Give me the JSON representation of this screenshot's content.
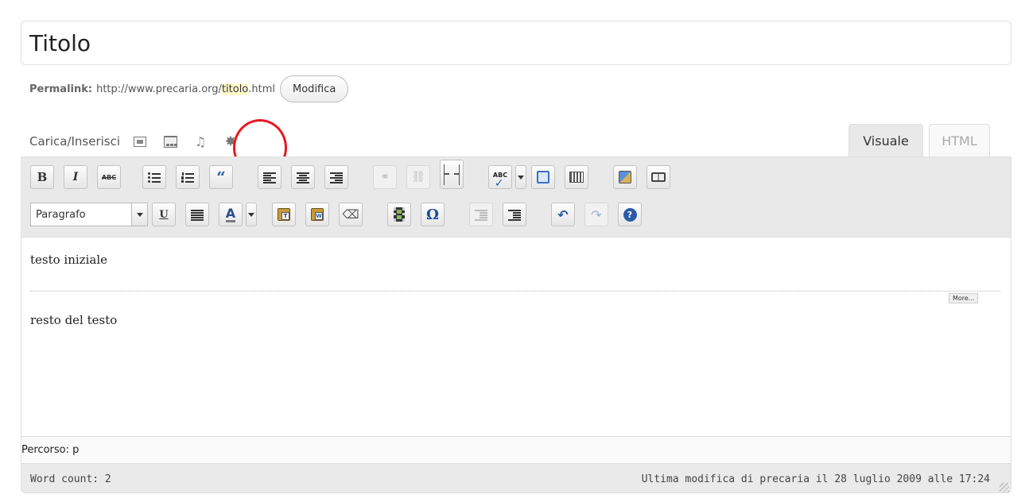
{
  "title": {
    "value": "Titolo"
  },
  "permalink": {
    "label": "Permalink:",
    "url_prefix": "http://www.precaria.org/",
    "slug": "titolo",
    "url_suffix": ".html",
    "edit_button": "Modifica"
  },
  "media": {
    "label": "Carica/Inserisci",
    "icons": [
      "image-icon",
      "video-icon",
      "audio-icon",
      "media-icon"
    ]
  },
  "tabs": [
    {
      "label": "Visuale",
      "active": true
    },
    {
      "label": "HTML",
      "active": false
    }
  ],
  "toolbar": {
    "bold": "B",
    "italic": "I",
    "strikethrough": "ABC",
    "format_select": "Paragrafo",
    "underline": "U",
    "text_color": "A",
    "special_char": "Ω"
  },
  "content": {
    "paragraph1": "testo iniziale",
    "more_tag": "More...",
    "paragraph2": "resto del testo"
  },
  "path": "Percorso: p",
  "status": {
    "word_count": "Word count: 2",
    "last_modified": "Ultima modifica di precaria il 28 luglio 2009 alle 17:24"
  },
  "colors": {
    "highlight_circle": "#e8181e",
    "slug_highlight": "#fffbcc",
    "toolbar_bg": "#e9e9e9"
  }
}
